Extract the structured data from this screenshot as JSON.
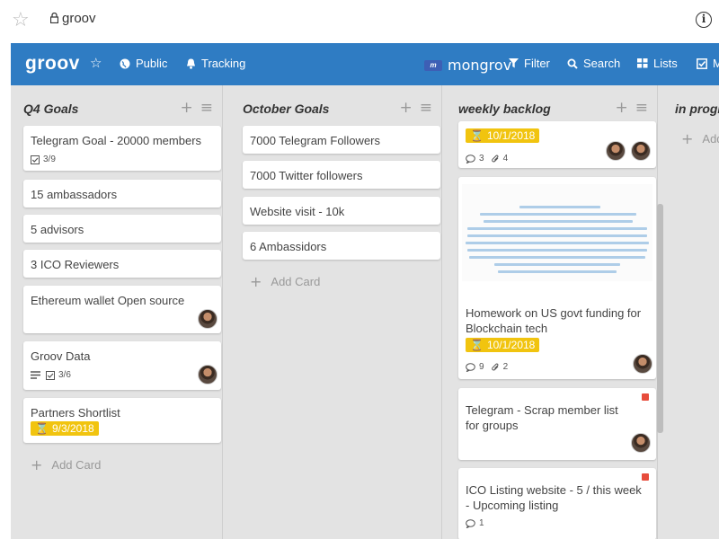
{
  "browser": {
    "url": "groov"
  },
  "header": {
    "brand": "groov",
    "public_label": "Public",
    "tracking_label": "Tracking",
    "org_logo_text": "m",
    "org_name": "mongrov",
    "filter_label": "Filter",
    "search_label": "Search",
    "lists_label": "Lists",
    "extra_label": "M"
  },
  "lists": [
    {
      "title": "Q4 Goals",
      "cards": [
        {
          "title": "Telegram Goal - 20000 members",
          "checklist": "3/9"
        },
        {
          "title": "15 ambassadors"
        },
        {
          "title": "5 advisors"
        },
        {
          "title": "3 ICO Reviewers"
        },
        {
          "title": "Ethereum wallet Open source"
        },
        {
          "title": "Groov Data",
          "checklist": "3/6"
        },
        {
          "title": "Partners Shortlist",
          "due": "9/3/2018"
        }
      ],
      "add_card": "Add Card"
    },
    {
      "title": "October Goals",
      "cards": [
        {
          "title": "7000 Telegram Followers"
        },
        {
          "title": "7000 Twitter followers"
        },
        {
          "title": "Website visit - 10k"
        },
        {
          "title": "6 Ambassidors"
        }
      ],
      "add_card": "Add Card"
    },
    {
      "title": "weekly backlog",
      "cards": [
        {
          "due": "10/1/2018",
          "comments": "3",
          "attachments": "4"
        },
        {
          "title": "Homework on US govt funding for Blockchain tech",
          "due": "10/1/2018",
          "comments": "9",
          "attachments": "2"
        },
        {
          "title": "Telegram - Scrap member list for groups"
        },
        {
          "title": "ICO Listing website - 5 / this week - Upcoming listing",
          "comments": "1"
        }
      ]
    },
    {
      "title": "in progre",
      "add_card": "Add"
    }
  ],
  "colors": {
    "header": "#2f7cc3",
    "due": "#f1c40f",
    "label_red": "#e74c3c"
  }
}
